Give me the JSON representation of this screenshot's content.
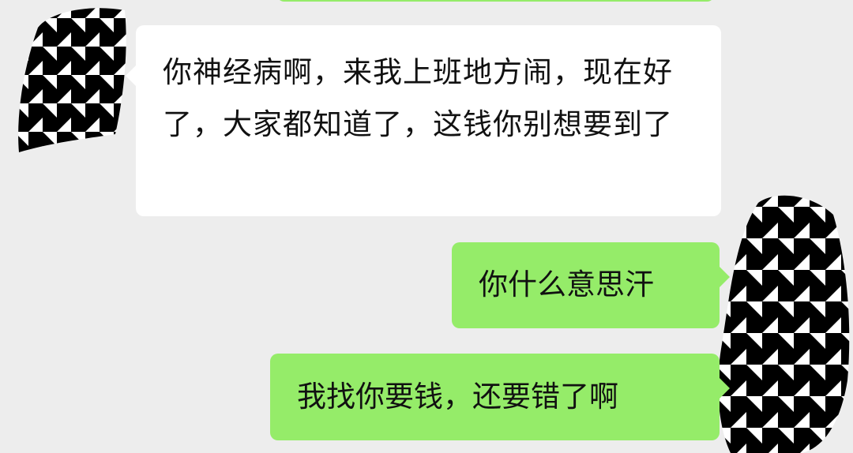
{
  "messages": [
    {
      "side": "left",
      "text": "你神经病啊，来我上班地方闹，现在好了，大家都知道了，这钱你别想要到了"
    },
    {
      "side": "right",
      "text": "你什么意思汗"
    },
    {
      "side": "right",
      "text": "我找你要钱，还要错了啊"
    }
  ],
  "colors": {
    "background": "#ededed",
    "incoming_bubble": "#ffffff",
    "outgoing_bubble": "#95ec69",
    "avatar_pattern": "houndstooth"
  }
}
